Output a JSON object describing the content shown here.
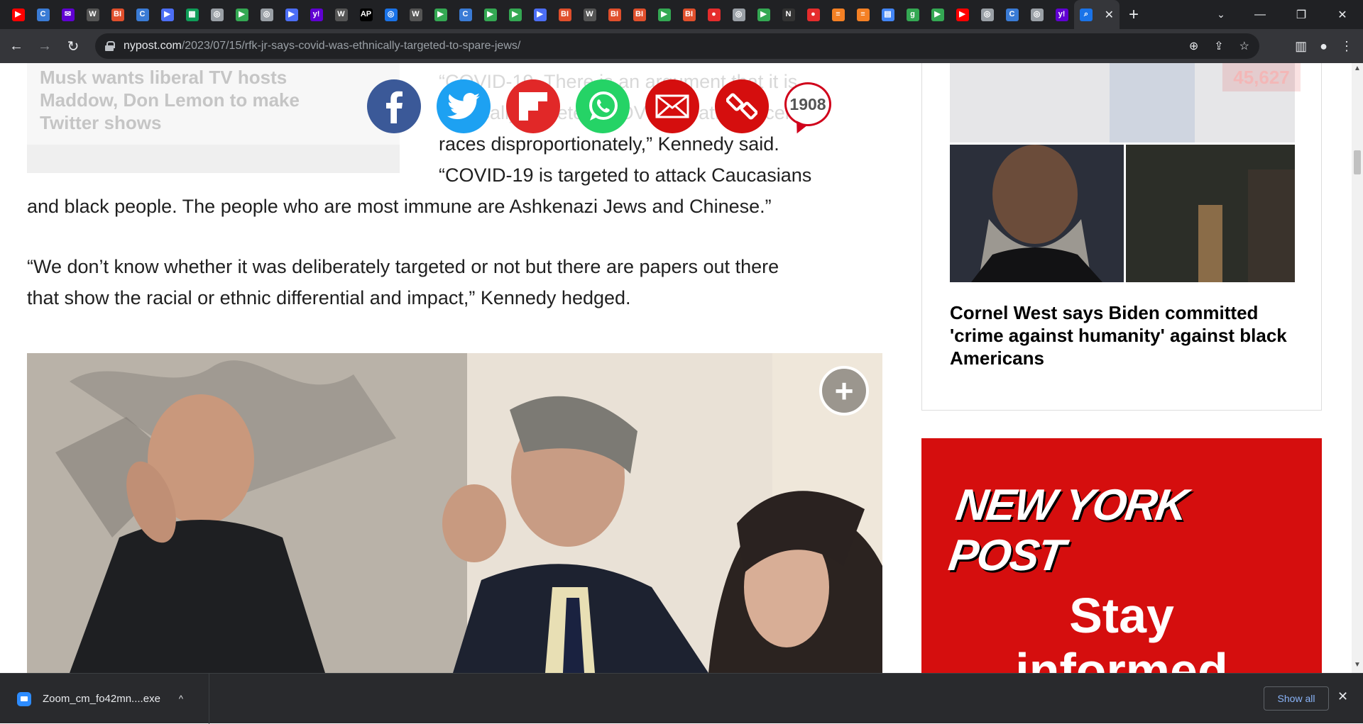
{
  "browser": {
    "tabs": [
      {
        "icon": "youtube-icon",
        "color": "#ff0000",
        "glyph": "▶"
      },
      {
        "icon": "generic-site-icon",
        "color": "#3a7bd5",
        "glyph": "C"
      },
      {
        "icon": "yahoo-mail-icon",
        "color": "#6001d2",
        "glyph": "✉"
      },
      {
        "icon": "wsj-icon",
        "color": "#555555",
        "glyph": "W"
      },
      {
        "icon": "business-insider-icon",
        "color": "#e04f2c",
        "glyph": "BI"
      },
      {
        "icon": "generic-site-icon",
        "color": "#3a7bd5",
        "glyph": "C"
      },
      {
        "icon": "forward-icon",
        "color": "#4c6ef5",
        "glyph": "▶"
      },
      {
        "icon": "sheets-icon",
        "color": "#0f9d58",
        "glyph": "▦"
      },
      {
        "icon": "globe-icon",
        "color": "#9aa0a6",
        "glyph": "◎"
      },
      {
        "icon": "play-icon",
        "color": "#34a853",
        "glyph": "▶"
      },
      {
        "icon": "globe-icon",
        "color": "#9aa0a6",
        "glyph": "◎"
      },
      {
        "icon": "forward-icon",
        "color": "#4c6ef5",
        "glyph": "▶"
      },
      {
        "icon": "yahoo-icon",
        "color": "#6001d2",
        "glyph": "y!"
      },
      {
        "icon": "wsj-icon",
        "color": "#555555",
        "glyph": "W"
      },
      {
        "icon": "ap-icon",
        "color": "#000000",
        "glyph": "AP"
      },
      {
        "icon": "globe-icon",
        "color": "#1a73e8",
        "glyph": "◎"
      },
      {
        "icon": "wsj-icon",
        "color": "#555555",
        "glyph": "W"
      },
      {
        "icon": "play-icon",
        "color": "#34a853",
        "glyph": "▶"
      },
      {
        "icon": "generic-site-icon",
        "color": "#3a7bd5",
        "glyph": "C"
      },
      {
        "icon": "play-icon",
        "color": "#34a853",
        "glyph": "▶"
      },
      {
        "icon": "play-icon",
        "color": "#34a853",
        "glyph": "▶"
      },
      {
        "icon": "forward-icon",
        "color": "#4c6ef5",
        "glyph": "▶"
      },
      {
        "icon": "business-insider-icon",
        "color": "#e04f2c",
        "glyph": "BI"
      },
      {
        "icon": "wsj-icon",
        "color": "#555555",
        "glyph": "W"
      },
      {
        "icon": "business-insider-icon",
        "color": "#e04f2c",
        "glyph": "BI"
      },
      {
        "icon": "business-insider-icon",
        "color": "#e04f2c",
        "glyph": "BI"
      },
      {
        "icon": "play-icon",
        "color": "#34a853",
        "glyph": "▶"
      },
      {
        "icon": "business-insider-icon",
        "color": "#e04f2c",
        "glyph": "BI"
      },
      {
        "icon": "podcast-icon",
        "color": "#e52c2c",
        "glyph": "●"
      },
      {
        "icon": "globe-icon",
        "color": "#9aa0a6",
        "glyph": "◎"
      },
      {
        "icon": "play-icon",
        "color": "#34a853",
        "glyph": "▶"
      },
      {
        "icon": "news-icon",
        "color": "#333333",
        "glyph": "N"
      },
      {
        "icon": "podcast-icon",
        "color": "#e52c2c",
        "glyph": "●"
      },
      {
        "icon": "stack-icon",
        "color": "#f48024",
        "glyph": "≡"
      },
      {
        "icon": "stack-icon",
        "color": "#f48024",
        "glyph": "≡"
      },
      {
        "icon": "document-icon",
        "color": "#4285f4",
        "glyph": "▤"
      },
      {
        "icon": "g-icon",
        "color": "#34a853",
        "glyph": "g"
      },
      {
        "icon": "play-icon",
        "color": "#34a853",
        "glyph": "▶"
      },
      {
        "icon": "youtube-icon",
        "color": "#ff0000",
        "glyph": "▶"
      },
      {
        "icon": "globe-icon",
        "color": "#9aa0a6",
        "glyph": "◎"
      },
      {
        "icon": "generic-site-icon",
        "color": "#3a7bd5",
        "glyph": "C"
      },
      {
        "icon": "globe-icon",
        "color": "#9aa0a6",
        "glyph": "◎"
      },
      {
        "icon": "yahoo-icon",
        "color": "#6001d2",
        "glyph": "y!"
      },
      {
        "icon": "search-icon",
        "color": "#1a73e8",
        "glyph": "⌕"
      }
    ],
    "url_domain": "nypost.com",
    "url_path": "/2023/07/15/rfk-jr-says-covid-was-ethnically-targeted-to-spare-jews/"
  },
  "related": {
    "title": "Musk wants liberal TV hosts Maddow, Don Lemon to make Twitter shows"
  },
  "share": {
    "comment_count": "1908",
    "buttons": [
      {
        "name": "facebook-share-button",
        "icon": "facebook-icon",
        "color": "#3b5998"
      },
      {
        "name": "twitter-share-button",
        "icon": "twitter-icon",
        "color": "#1da1f2"
      },
      {
        "name": "flipboard-share-button",
        "icon": "flipboard-icon",
        "color": "#e12828"
      },
      {
        "name": "whatsapp-share-button",
        "icon": "whatsapp-icon",
        "color": "#25d366"
      },
      {
        "name": "email-share-button",
        "icon": "email-icon",
        "color": "#d50e0e"
      },
      {
        "name": "copy-link-button",
        "icon": "link-icon",
        "color": "#d50e0e"
      }
    ]
  },
  "article": {
    "faded_line1": "“COVID-19. There is an argument that it is",
    "faded_line2": "ethnically targeted. COVID-19 attacks certain",
    "line3": "races disproportionately,” Kennedy said.",
    "line4": "“COVID-19 is targeted to attack Caucasians",
    "line5": "and black people. The people who are most immune are Ashkenazi Jews and Chinese.”",
    "para2_line1": "“We don’t know whether it was deliberately targeted or not but there are papers out there",
    "para2_line2": "that show the racial or ethnic differential and impact,” Kennedy hedged."
  },
  "sidebar": {
    "view_count": "45,627",
    "headline": "Cornel West says Biden committed 'crime against humanity' against black Americans"
  },
  "ad": {
    "logo": "NEW YORK POST",
    "line1": "Stay",
    "line2": "informed"
  },
  "downloads": {
    "file_name": "Zoom_cm_fo42mn....exe",
    "show_all": "Show all"
  }
}
